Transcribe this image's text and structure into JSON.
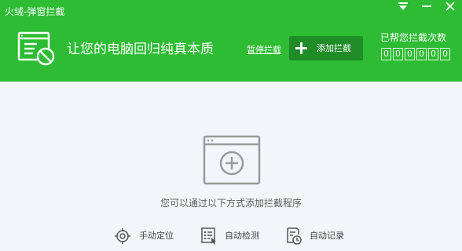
{
  "window": {
    "title": "火绒-弹窗拦截"
  },
  "header": {
    "slogan": "让您的电脑回归纯真本质",
    "pause_label": "暂停拦截",
    "add_label": "添加拦截",
    "count_label": "已帮您拦截次数",
    "count_digits": [
      "0",
      "0",
      "0",
      "0",
      "0",
      "0"
    ],
    "accent_color": "#2dbc33",
    "button_color": "#1f8c27"
  },
  "main": {
    "hint": "您可以通过以下方式添加拦截程序",
    "methods": [
      {
        "label": "手动定位",
        "icon": "crosshair-icon"
      },
      {
        "label": "自动检测",
        "icon": "scan-list-icon"
      },
      {
        "label": "自动记录",
        "icon": "clock-document-icon"
      }
    ]
  }
}
